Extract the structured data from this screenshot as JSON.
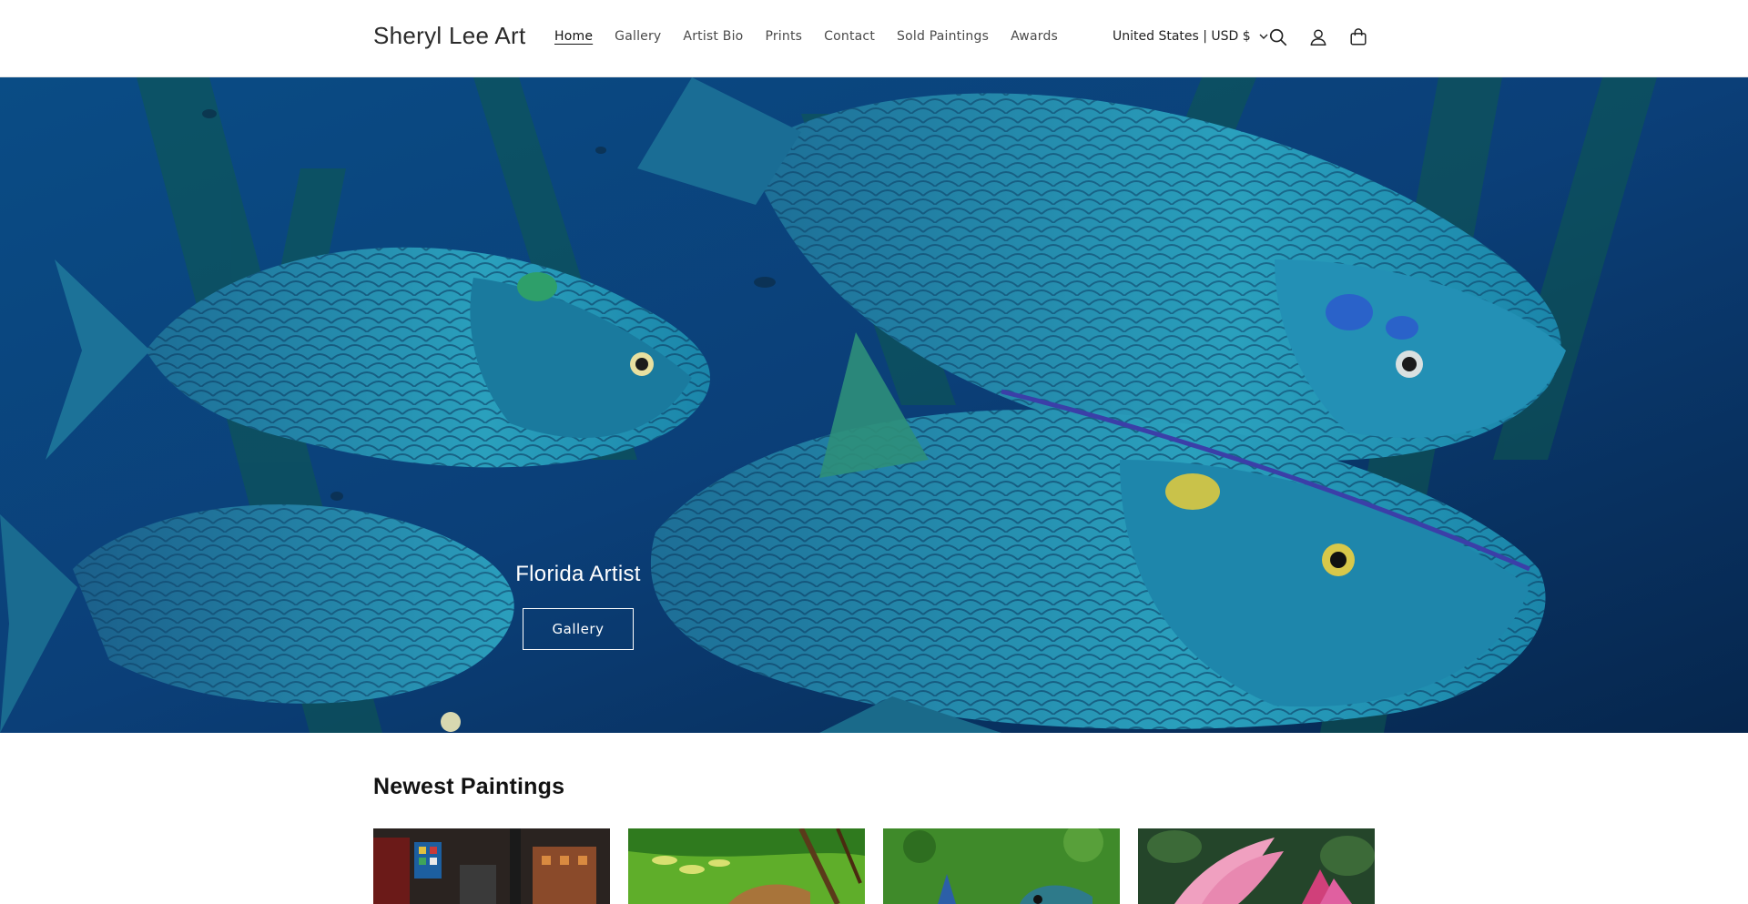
{
  "header": {
    "logo": "Sheryl Lee Art",
    "nav": [
      {
        "label": "Home",
        "active": true
      },
      {
        "label": "Gallery",
        "active": false
      },
      {
        "label": "Artist Bio",
        "active": false
      },
      {
        "label": "Prints",
        "active": false
      },
      {
        "label": "Contact",
        "active": false
      },
      {
        "label": "Sold Paintings",
        "active": false
      },
      {
        "label": "Awards",
        "active": false
      }
    ],
    "locale": "United States | USD $",
    "icons": [
      "search-icon",
      "account-icon",
      "cart-icon"
    ]
  },
  "hero": {
    "title": "Florida Artist",
    "button_label": "Gallery"
  },
  "newest": {
    "title": "Newest Paintings"
  },
  "colors": {
    "hero_blue": "#0a3b6e",
    "fish_teal": "#2fb0c4",
    "text": "#121212"
  }
}
